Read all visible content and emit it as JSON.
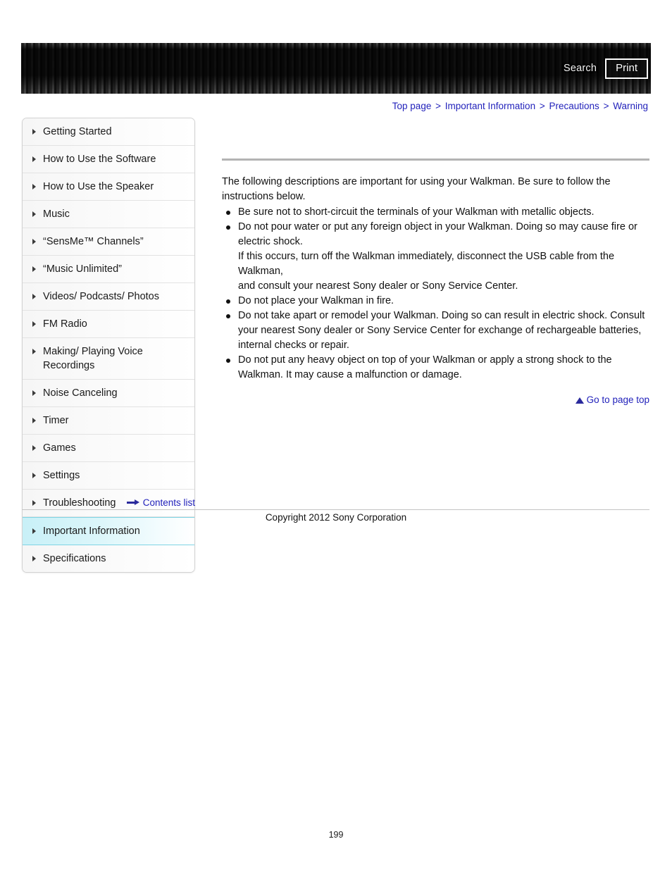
{
  "header": {
    "search_label": "Search",
    "print_label": "Print",
    "search_icon": "search-icon",
    "print_icon": "printer-icon"
  },
  "breadcrumb": {
    "separator": ">",
    "items": [
      {
        "label": "Top page"
      },
      {
        "label": "Important Information"
      },
      {
        "label": "Precautions"
      },
      {
        "label": "Warning"
      }
    ]
  },
  "sidebar": {
    "items": [
      {
        "label": "Getting Started",
        "selected": false
      },
      {
        "label": "How to Use the Software",
        "selected": false
      },
      {
        "label": "How to Use the Speaker",
        "selected": false
      },
      {
        "label": "Music",
        "selected": false
      },
      {
        "label": "“SensMe™ Channels”",
        "selected": false
      },
      {
        "label": "“Music Unlimited”",
        "selected": false
      },
      {
        "label": "Videos/ Podcasts/ Photos",
        "selected": false
      },
      {
        "label": "FM Radio",
        "selected": false
      },
      {
        "label": "Making/ Playing Voice Recordings",
        "selected": false
      },
      {
        "label": "Noise Canceling",
        "selected": false
      },
      {
        "label": "Timer",
        "selected": false
      },
      {
        "label": "Games",
        "selected": false
      },
      {
        "label": "Settings",
        "selected": false
      },
      {
        "label": "Troubleshooting",
        "selected": false
      },
      {
        "label": "Important Information",
        "selected": true
      },
      {
        "label": "Specifications",
        "selected": false
      }
    ],
    "selected_bg_color": "#c8f0f7",
    "selected_border_color": "#7fd4e4"
  },
  "contents_link": {
    "label": "Contents list",
    "icon": "arrow-right-icon"
  },
  "main": {
    "intro_line_1": "The following descriptions are important for using your Walkman. Be sure to follow the",
    "intro_line_2": "instructions below.",
    "bullets": [
      {
        "text": "Be sure not to short-circuit the terminals of your Walkman with metallic objects.",
        "continuation": []
      },
      {
        "text": "Do not pour water or put any foreign object in your Walkman. Doing so may cause fire or electric shock.",
        "continuation": [
          "If this occurs, turn off the Walkman immediately, disconnect the USB cable from the Walkman,",
          "and consult your nearest Sony dealer or Sony Service Center."
        ]
      },
      {
        "text": "Do not place your Walkman in fire.",
        "continuation": []
      },
      {
        "text": "Do not take apart or remodel your Walkman. Doing so can result in electric shock. Consult your nearest Sony dealer or Sony Service Center for exchange of rechargeable batteries, internal checks or repair.",
        "continuation": []
      },
      {
        "text": "Do not put any heavy object on top of your Walkman or apply a strong shock to the Walkman. It may cause a malfunction or damage.",
        "continuation": []
      }
    ],
    "goto_top_label": "Go to page top",
    "goto_top_icon": "triangle-up-icon"
  },
  "footer": {
    "copyright": "Copyright 2012 Sony Corporation",
    "page_number": "199"
  },
  "colors": {
    "link": "#2222bb",
    "rule": "#b3b3b3",
    "banner_dark": "#2a2a2a"
  }
}
